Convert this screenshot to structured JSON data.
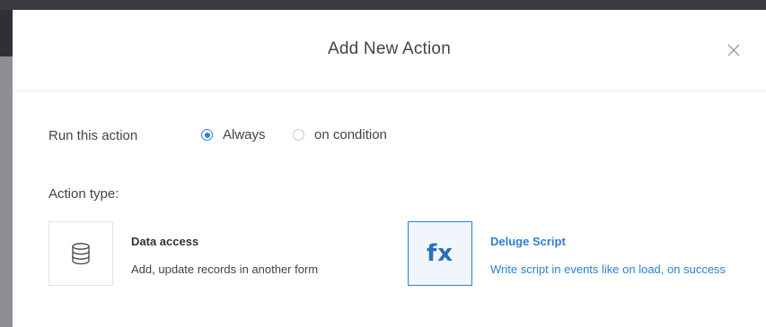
{
  "modal": {
    "title": "Add New Action"
  },
  "run_action": {
    "label": "Run this action",
    "options": [
      {
        "label": "Always",
        "selected": true
      },
      {
        "label": "on condition",
        "selected": false
      }
    ]
  },
  "action_type": {
    "label": "Action type:",
    "cards": [
      {
        "title": "Data access",
        "description": "Add, update records in another form",
        "icon": "database-icon",
        "selected": false
      },
      {
        "title": "Deluge Script",
        "description": "Write script in events like on load, on success",
        "icon": "fx-icon",
        "icon_text": "fx",
        "selected": true
      }
    ]
  },
  "colors": {
    "accent": "#2d7fd3",
    "text": "#444444",
    "topbar": "#3a3c40",
    "backdrop": "#8e8f92"
  }
}
